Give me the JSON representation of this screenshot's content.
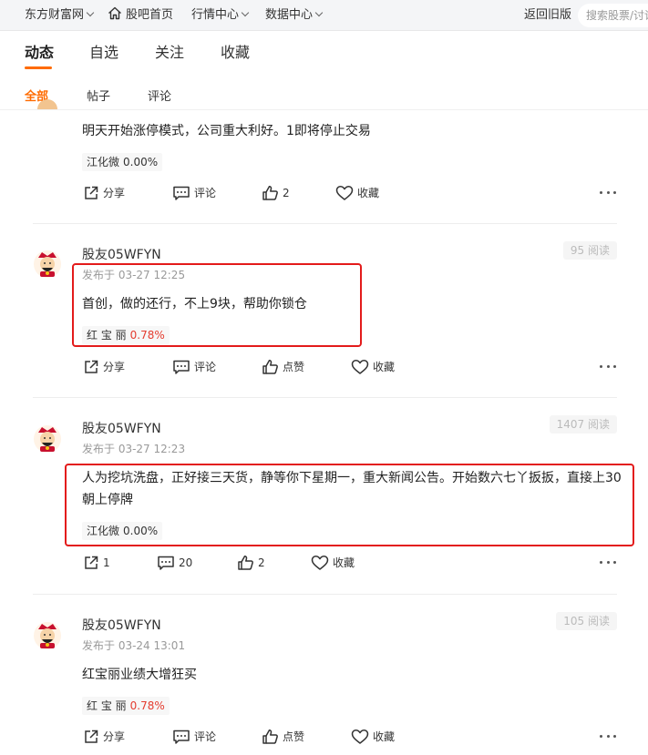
{
  "topnav": {
    "site": "东方财富网",
    "home": "股吧首页",
    "market": "行情中心",
    "data": "数据中心",
    "old_version": "返回旧版",
    "search_placeholder": "搜索股票/讨论"
  },
  "tabs": [
    "动态",
    "自选",
    "关注",
    "收藏"
  ],
  "subtabs": [
    "全部",
    "帖子",
    "评论"
  ],
  "colors": {
    "accent": "#ff6b00",
    "up": "#e43c2f",
    "annotation": "#e31b1b"
  },
  "posts": [
    {
      "content": "明天开始涨停模式，公司重大利好。1即将停止交易",
      "stock": "江化微",
      "change": "0.00%",
      "share": "分享",
      "comment": "评论",
      "like": "2",
      "collect": "收藏"
    },
    {
      "author": "股友05WFYN",
      "time": "发布于 03-27 12:25",
      "reads": "95 阅读",
      "content": "首创，做的还行，不上9块，帮助你锁仓",
      "stock": "红 宝 丽",
      "change": "0.78%",
      "share": "分享",
      "comment": "评论",
      "like": "点赞",
      "collect": "收藏"
    },
    {
      "author": "股友05WFYN",
      "time": "发布于 03-27 12:23",
      "reads": "1407 阅读",
      "content": "人为挖坑洗盘，正好接三天货，静等你下星期一，重大新闻公告。开始数六七丫扳扳，直接上30朝上停牌",
      "stock": "江化微",
      "change": "0.00%",
      "share": "1",
      "comment": "20",
      "like": "2",
      "collect": "收藏"
    },
    {
      "author": "股友05WFYN",
      "time": "发布于 03-24 13:01",
      "reads": "105 阅读",
      "content": "红宝丽业绩大增狂买",
      "stock": "红 宝 丽",
      "change": "0.78%",
      "share": "分享",
      "comment": "评论",
      "like": "点赞",
      "collect": "收藏"
    }
  ]
}
